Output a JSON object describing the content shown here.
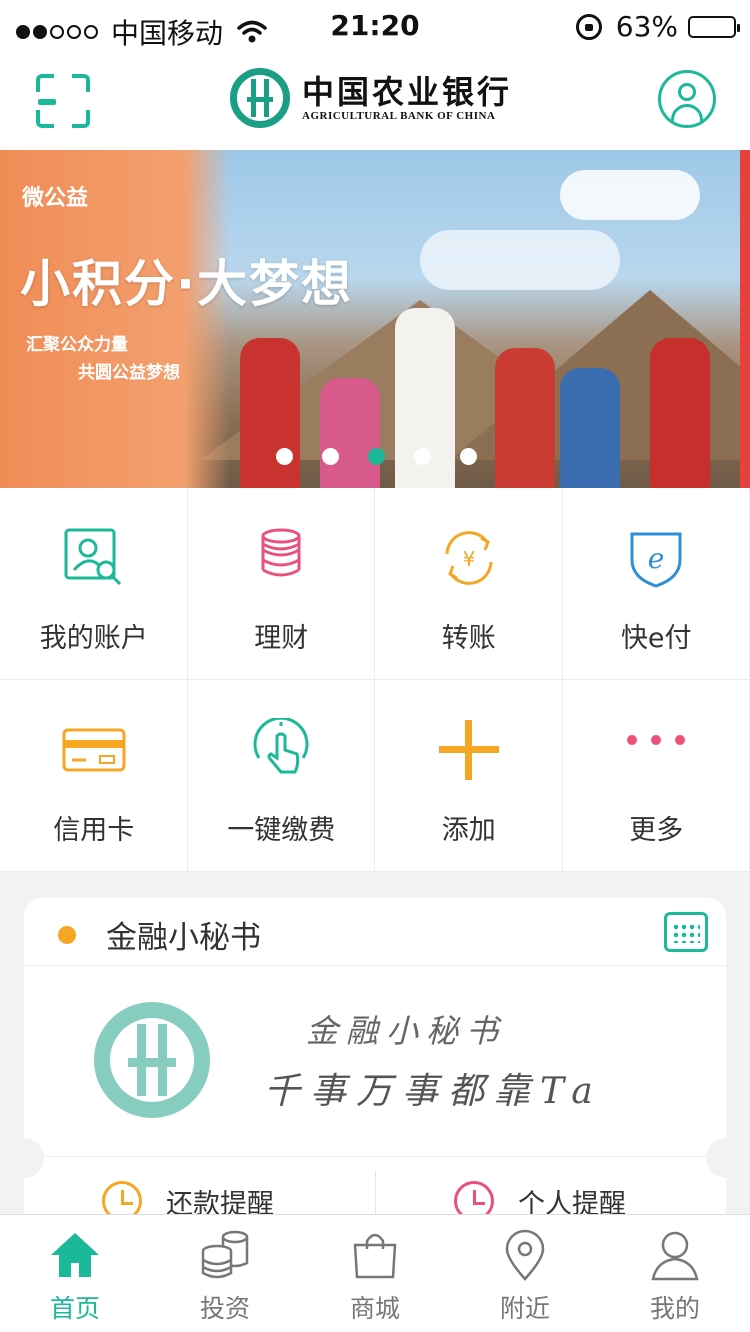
{
  "status_bar": {
    "carrier": "中国移动",
    "time": "21:20",
    "battery": "63%",
    "battery_level": 0.63
  },
  "header": {
    "bank_name_cn": "中国农业银行",
    "bank_name_en": "AGRICULTURAL BANK OF CHINA",
    "scan_icon": "scan-icon",
    "user_icon": "user-avatar-icon"
  },
  "banner": {
    "tag": "微公益",
    "title": "小积分·大梦想",
    "subtitle_line1": "汇聚公众力量",
    "subtitle_line2": "共圆公益梦想",
    "pages": 5,
    "active_page": 2
  },
  "grid": {
    "items": [
      {
        "label": "我的账户",
        "icon": "account-search-icon",
        "color": "#1bb99a"
      },
      {
        "label": "理财",
        "icon": "coins-stack-icon",
        "color": "#e8517a"
      },
      {
        "label": "转账",
        "icon": "yuan-transfer-icon",
        "color": "#f5a623"
      },
      {
        "label": "快e付",
        "icon": "e-shield-icon",
        "color": "#2f8fd8"
      },
      {
        "label": "信用卡",
        "icon": "credit-card-icon",
        "color": "#f5a623"
      },
      {
        "label": "一键缴费",
        "icon": "tap-pay-icon",
        "color": "#1bb99a"
      },
      {
        "label": "添加",
        "icon": "plus-icon",
        "color": "#f5a623"
      },
      {
        "label": "更多",
        "icon": "more-dots-icon",
        "color": "#e8517a"
      }
    ]
  },
  "assistant": {
    "title": "金融小秘书",
    "handwriting_line1": "金融小秘书",
    "handwriting_line2": "千事万事都靠Ta",
    "reminder_left": "还款提醒",
    "reminder_right": "个人提醒"
  },
  "tabbar": {
    "items": [
      {
        "label": "首页",
        "icon": "home-icon",
        "active": true
      },
      {
        "label": "投资",
        "icon": "coins-icon",
        "active": false
      },
      {
        "label": "商城",
        "icon": "shopping-bag-icon",
        "active": false
      },
      {
        "label": "附近",
        "icon": "location-pin-icon",
        "active": false
      },
      {
        "label": "我的",
        "icon": "profile-icon",
        "active": false
      }
    ]
  },
  "colors": {
    "accent": "#1bb99a",
    "orange": "#f5a623",
    "pink": "#e8517a",
    "blue": "#2f8fd8"
  }
}
